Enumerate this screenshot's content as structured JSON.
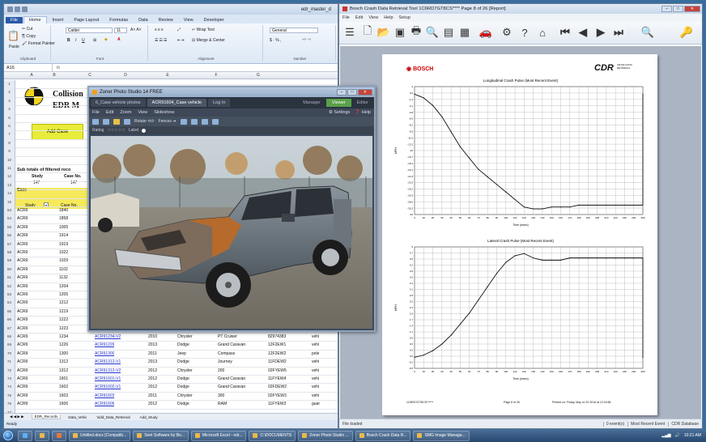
{
  "excel": {
    "title": "edr_master_d",
    "tabs": [
      "File",
      "Home",
      "Insert",
      "Page Layout",
      "Formulas",
      "Data",
      "Review",
      "View",
      "Developer"
    ],
    "ribbon": {
      "cut": "Cut",
      "copy": "Copy",
      "format_painter": "Format Painter",
      "paste": "Paste",
      "font_name": "Calibri",
      "font_size": "11",
      "wrap_text": "Wrap Text",
      "merge": "Merge & Center",
      "number_format": "General",
      "groups": [
        "Clipboard",
        "Font",
        "Alignment",
        "Number"
      ]
    },
    "name_box": "A16",
    "columns": [
      "A",
      "B",
      "C",
      "D",
      "E",
      "F",
      "G"
    ],
    "sheet_title_1": "Collision",
    "sheet_title_2": "EDR M",
    "add_case": "Add Case",
    "subtotals_label": "Sub totals of filtered reco",
    "study_hdr": "Study",
    "case_no_hdr": "Case No.",
    "study_count": "147",
    "case_count": "147",
    "case_label": "Case",
    "filter_study": "Study",
    "filter_case": "Case No.",
    "row_numbers": [
      "1",
      "2",
      "3",
      "4",
      "5",
      "6",
      "7",
      "8",
      "9",
      "10",
      "11",
      "12",
      "13",
      "14",
      "15",
      "53",
      "54",
      "55",
      "56",
      "57",
      "58",
      "59",
      "60",
      "61",
      "62",
      "63",
      "64",
      "65",
      "66",
      "67",
      "68",
      "69",
      "70",
      "71",
      "72",
      "73",
      "74",
      "75",
      "76",
      "77"
    ],
    "rows": [
      {
        "study": "ACR9",
        "case": "1840"
      },
      {
        "study": "ACR9",
        "case": "1858"
      },
      {
        "study": "ACR9",
        "case": "1005"
      },
      {
        "study": "ACR9",
        "case": "1914"
      },
      {
        "study": "ACR9",
        "case": "1919"
      },
      {
        "study": "ACR9",
        "case": "1022"
      },
      {
        "study": "ACR9",
        "case": "1029"
      },
      {
        "study": "ACR9",
        "case": "1102"
      },
      {
        "study": "ACR9",
        "case": "1132"
      },
      {
        "study": "ACR9",
        "case": "1204"
      },
      {
        "study": "ACR9",
        "case": "1205"
      },
      {
        "study": "ACR9",
        "case": "1212"
      },
      {
        "study": "ACR9",
        "case": "1219"
      },
      {
        "study": "ACR9",
        "case": "1222"
      },
      {
        "study": "ACR9",
        "case": "1223"
      },
      {
        "study": "ACR9",
        "case": "1234",
        "link": "ACR91234-V2",
        "year": "2010",
        "make": "Chrysler",
        "model": "PT Cruiser",
        "vin": "82974383",
        "extra": "vehi"
      },
      {
        "study": "ACR9",
        "case": "1226",
        "link": "ACR91226",
        "year": "2013",
        "make": "Dodge",
        "model": "Grand Caravan",
        "vin": "12F2EW1",
        "extra": "vehi"
      },
      {
        "study": "ACR9",
        "case": "1300",
        "link": "ACR91300",
        "year": "2011",
        "make": "Jeep",
        "model": "Compass",
        "vin": "12F2EW2",
        "extra": "pole"
      },
      {
        "study": "ACR9",
        "case": "1312",
        "link": "ACR91312-V1",
        "year": "2013",
        "make": "Dodge",
        "model": "Journey",
        "vin": "11FDEW2",
        "extra": "vehi"
      },
      {
        "study": "ACR9",
        "case": "1312",
        "link": "ACR91312-V2",
        "year": "2012",
        "make": "Chrysler",
        "model": "200",
        "vin": "02FYEW5",
        "extra": "vehi"
      },
      {
        "study": "ACR9",
        "case": "1601",
        "link": "ACR91601-V1",
        "year": "2012",
        "make": "Dodge",
        "model": "Grand Caravan",
        "vin": "11FYEW4",
        "extra": "vehi"
      },
      {
        "study": "ACR9",
        "case": "1602",
        "link": "ACR91602-V1",
        "year": "2012",
        "make": "Dodge",
        "model": "Grand Caravan",
        "vin": "02FDEW2",
        "extra": "vehi"
      },
      {
        "study": "ACR9",
        "case": "1603",
        "link": "ACR91603",
        "year": "2011",
        "make": "Chrysler",
        "model": "300",
        "vin": "02FYEW3",
        "extra": "vehi"
      },
      {
        "study": "ACR9",
        "case": "1606",
        "link": "ACR91606",
        "year": "2012",
        "make": "Dodge",
        "model": "RAM",
        "vin": "11FYEW3",
        "extra": "guar"
      }
    ],
    "sheet_tabs": [
      "EDR_Records",
      "Data_Vehic",
      "Vidd_Data_Retrieval",
      "Add_Study"
    ],
    "status": "Ready"
  },
  "zoner": {
    "title": "Zoner Photo Studio 14 FREE",
    "tabs": [
      "6_Case vehicle photos",
      "ACR91604_Case vehicle",
      "Log In"
    ],
    "modes": [
      "Manager",
      "Viewer",
      "Editor"
    ],
    "active_mode": "Viewer",
    "menu": [
      "File",
      "Edit",
      "Zoom",
      "View",
      "Slideshow"
    ],
    "settings": "Settings",
    "help": "Help",
    "tool_labels": [
      "Rotate",
      "Fences"
    ],
    "rating_label": "Rating",
    "label_label": "Label"
  },
  "bosch": {
    "title": "Bosch Crash Data Retrieval Tool  1C6RD7GT8CS****  Page 8 of 26   [Report]",
    "menu": [
      "File",
      "Edit",
      "View",
      "Help",
      "Setup"
    ],
    "brand": "BOSCH",
    "cdr_logo": "CDR",
    "cdr_sub": "CRASH DATA RETRIEVAL",
    "chart1_title": "Longitudinal Crash Pulse (Most Recent Event)",
    "chart2_title": "Lateral Crash Pulse (Most Recent Event)",
    "chart_y_label_1": "MPH",
    "chart_y_label_2": "MPH",
    "chart_x_label": "Time (msec)",
    "footer_left": "1C6RD7GT8CS******",
    "footer_mid": "Page 8 of 26",
    "footer_right": "Printed on: Friday, May xx 20 2016 at 12:34:56",
    "status_left": "File loaded",
    "status_right": [
      "0 event(s)",
      "Most Recent Event",
      "CDR Database"
    ]
  },
  "taskbar": {
    "items": [
      "Untitled.docx [Compatib...",
      "Sent Software by Bo...",
      "Microsoft Excel - edr...",
      "C:\\DOCUMENTS",
      "Zoner Photo Studio ...",
      "Bosch Crash Data R...",
      "SMG Image Manage..."
    ],
    "time": "10:21 AM"
  },
  "chart_data": [
    {
      "type": "line",
      "title": "Longitudinal Crash Pulse (Most Recent Event)",
      "xlabel": "Time (msec)",
      "ylabel": "MPH",
      "x": [
        0,
        10,
        20,
        30,
        40,
        50,
        60,
        70,
        80,
        90,
        100,
        110,
        120,
        130,
        140,
        150,
        160,
        170,
        180,
        190,
        200,
        210,
        220,
        230,
        240,
        250
      ],
      "series": [
        {
          "values": [
            0,
            -1,
            -3,
            -6,
            -10,
            -14,
            -17,
            -20,
            -22,
            -24,
            -26,
            -28,
            -30,
            -30.5,
            -30.5,
            -30,
            -30,
            -30,
            -29.5,
            -29.5,
            -29.5,
            -29.5,
            -29.5,
            -29.5,
            -29.5,
            0
          ]
        }
      ],
      "ylim": [
        -32,
        2
      ]
    },
    {
      "type": "line",
      "title": "Lateral Crash Pulse (Most Recent Event)",
      "xlabel": "Time (msec)",
      "ylabel": "MPH",
      "x": [
        0,
        10,
        20,
        30,
        40,
        50,
        60,
        70,
        80,
        90,
        100,
        110,
        120,
        130,
        140,
        150,
        160,
        170,
        180,
        190,
        200,
        210,
        220,
        230,
        240,
        250
      ],
      "series": [
        {
          "values": [
            0,
            0.1,
            0.3,
            0.6,
            1.0,
            1.5,
            2.0,
            2.6,
            3.2,
            3.8,
            4.3,
            4.6,
            4.7,
            4.5,
            4.4,
            4.4,
            4.4,
            4.5,
            4.5,
            4.5,
            4.5,
            4.5,
            4.5,
            4.5,
            4.5,
            0
          ]
        }
      ],
      "ylim": [
        -0.5,
        5
      ]
    }
  ]
}
